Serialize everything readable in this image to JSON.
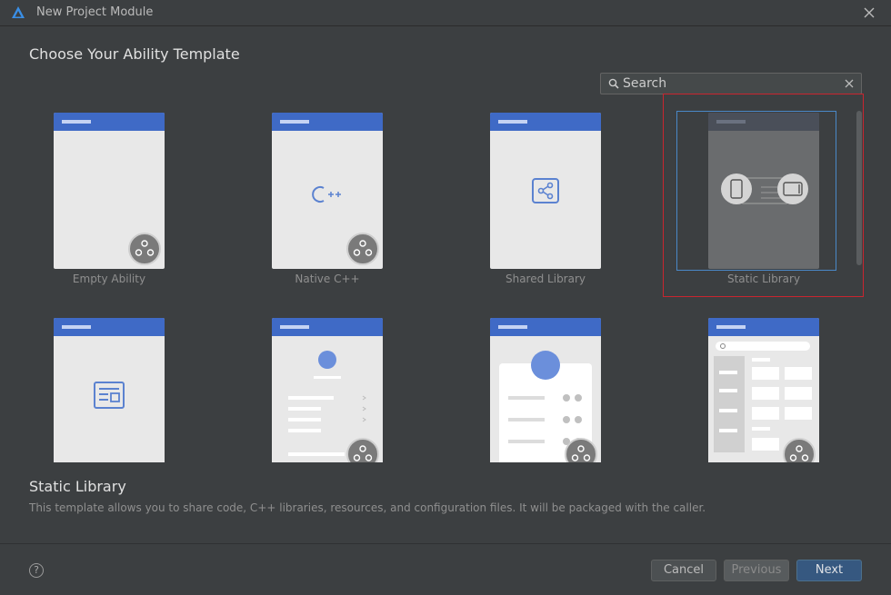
{
  "window": {
    "title": "New Project Module"
  },
  "page": {
    "heading": "Choose Your Ability Template"
  },
  "search": {
    "value": "",
    "placeholder": "Search"
  },
  "templates": [
    {
      "label": "Empty Ability",
      "selected": false
    },
    {
      "label": "Native C++",
      "selected": false
    },
    {
      "label": "Shared Library",
      "selected": false
    },
    {
      "label": "Static Library",
      "selected": true
    },
    {
      "label": "",
      "selected": false
    },
    {
      "label": "",
      "selected": false
    },
    {
      "label": "",
      "selected": false
    },
    {
      "label": "",
      "selected": false
    }
  ],
  "description": {
    "title": "Static Library",
    "text": "This template allows you to share code, C++ libraries, resources, and configuration files. It will be packaged with the caller."
  },
  "footer": {
    "help_glyph": "?",
    "cancel_label": "Cancel",
    "previous_label": "Previous",
    "next_label": "Next"
  },
  "colors": {
    "accent": "#3f6ac6",
    "selection_frame": "#4a88c7",
    "highlight_box": "#c9252f",
    "primary_button": "#365880"
  }
}
